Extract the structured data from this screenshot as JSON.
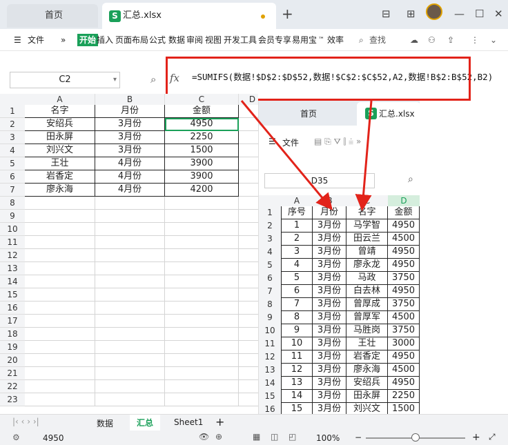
{
  "window": {
    "tab_home": "首页",
    "tab_file": "汇总.xlsx",
    "logo_letter": "S",
    "add_tab": "+"
  },
  "ribbon": {
    "menu_label": "文件",
    "more": "»",
    "start": "开始",
    "items": [
      "插入",
      "页面布局",
      "公式",
      "数据",
      "审阅",
      "视图",
      "开发工具",
      "会员专享",
      "易用宝",
      "效率"
    ],
    "tm": "™",
    "search": "查找"
  },
  "formula_bar": {
    "name_box": "C2",
    "fx": "fx",
    "formula": "=SUMIFS(数据!$D$2:$D$52,数据!$C$2:$C$52,A2,数据!B$2:B$52,B2)"
  },
  "left_sheet": {
    "columns": [
      "A",
      "B",
      "C",
      "D"
    ],
    "rows": [
      "1",
      "2",
      "3",
      "4",
      "5",
      "6",
      "7",
      "8",
      "9",
      "10",
      "11",
      "12",
      "13",
      "14",
      "15",
      "16",
      "17",
      "18",
      "19",
      "20",
      "21",
      "22",
      "23"
    ],
    "header": [
      "名字",
      "月份",
      "金额"
    ],
    "data": [
      [
        "安绍兵",
        "3月份",
        "4950"
      ],
      [
        "田永屏",
        "3月份",
        "2250"
      ],
      [
        "刘兴文",
        "3月份",
        "1500"
      ],
      [
        "王壮",
        "4月份",
        "3900"
      ],
      [
        "岩香定",
        "4月份",
        "3900"
      ],
      [
        "廖永海",
        "4月份",
        "4200"
      ]
    ]
  },
  "inner_window": {
    "tab_home": "首页",
    "tab_file": "汇总.xlsx",
    "menu_label": "文件",
    "name_box": "D35",
    "columns": [
      "A",
      "B",
      "C",
      "D"
    ],
    "rows": [
      "1",
      "2",
      "3",
      "4",
      "5",
      "6",
      "7",
      "8",
      "9",
      "10",
      "11",
      "12",
      "13",
      "14",
      "15",
      "16"
    ],
    "header": [
      "序号",
      "月份",
      "名字",
      "金额"
    ],
    "data": [
      [
        "1",
        "3月份",
        "马学智",
        "4950"
      ],
      [
        "2",
        "3月份",
        "田云兰",
        "4500"
      ],
      [
        "3",
        "3月份",
        "曾靖",
        "4950"
      ],
      [
        "4",
        "3月份",
        "廖永龙",
        "4950"
      ],
      [
        "5",
        "3月份",
        "马政",
        "3750"
      ],
      [
        "6",
        "3月份",
        "白去林",
        "4950"
      ],
      [
        "7",
        "3月份",
        "曾厚成",
        "3750"
      ],
      [
        "8",
        "3月份",
        "曾厚军",
        "4500"
      ],
      [
        "9",
        "3月份",
        "马胜岗",
        "3750"
      ],
      [
        "10",
        "3月份",
        "王壮",
        "3000"
      ],
      [
        "11",
        "3月份",
        "岩香定",
        "4950"
      ],
      [
        "12",
        "3月份",
        "廖永海",
        "4500"
      ],
      [
        "13",
        "3月份",
        "安绍兵",
        "4950"
      ],
      [
        "14",
        "3月份",
        "田永屏",
        "2250"
      ],
      [
        "15",
        "3月份",
        "刘兴文",
        "1500"
      ]
    ]
  },
  "sheet_tabs": [
    "数据",
    "汇总",
    "Sheet1"
  ],
  "status": {
    "value": "4950",
    "zoom": "100%",
    "plus": "+",
    "minus": "−"
  },
  "colors": {
    "accent_green": "#1aa059",
    "highlight_red": "#e2231a",
    "arrow_red": "#e2231a"
  }
}
